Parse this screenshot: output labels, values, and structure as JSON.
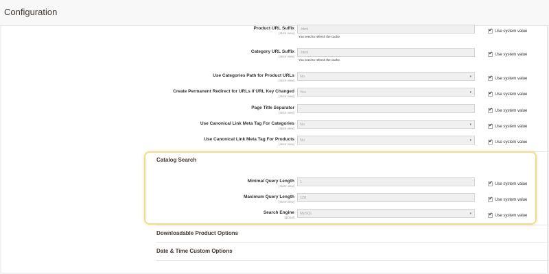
{
  "page": {
    "title": "Configuration"
  },
  "use_system_label": "Use system value",
  "check_glyph": "✔",
  "select_arrow": "▾",
  "seo_rows": [
    {
      "label": "Product URL Suffix",
      "scope": "[store view]",
      "value": ".html",
      "type": "text",
      "note": "You need to refresh the cache.",
      "checked": true
    },
    {
      "label": "Category URL Suffix",
      "scope": "[store view]",
      "value": ".html",
      "type": "text",
      "note": "You need to refresh the cache.",
      "checked": true
    },
    {
      "label": "Use Categories Path for Product URLs",
      "scope": "[store view]",
      "value": "No",
      "type": "select",
      "note": "",
      "checked": true
    },
    {
      "label": "Create Permanent Redirect for URLs if URL Key Changed",
      "scope": "[store view]",
      "value": "Yes",
      "type": "select",
      "note": "",
      "checked": true
    },
    {
      "label": "Page Title Separator",
      "scope": "[store view]",
      "value": "-",
      "type": "text",
      "note": "",
      "checked": true
    },
    {
      "label": "Use Canonical Link Meta Tag For Categories",
      "scope": "[store view]",
      "value": "No",
      "type": "select",
      "note": "",
      "checked": true
    },
    {
      "label": "Use Canonical Link Meta Tag For Products",
      "scope": "[store view]",
      "value": "No",
      "type": "select",
      "note": "",
      "checked": true
    }
  ],
  "catalog_search": {
    "title": "Catalog Search",
    "rows": [
      {
        "label": "Minimal Query Length",
        "scope": "[store view]",
        "value": "1",
        "type": "text",
        "checked": true
      },
      {
        "label": "Maximum Query Length",
        "scope": "[store view]",
        "value": "128",
        "type": "text",
        "checked": true
      },
      {
        "label": "Search Engine",
        "scope": "[global]",
        "value": "MySQL",
        "type": "select",
        "checked": true
      }
    ]
  },
  "collapsed_sections": [
    {
      "title": "Downloadable Product Options"
    },
    {
      "title": "Date & Time Custom Options"
    }
  ]
}
